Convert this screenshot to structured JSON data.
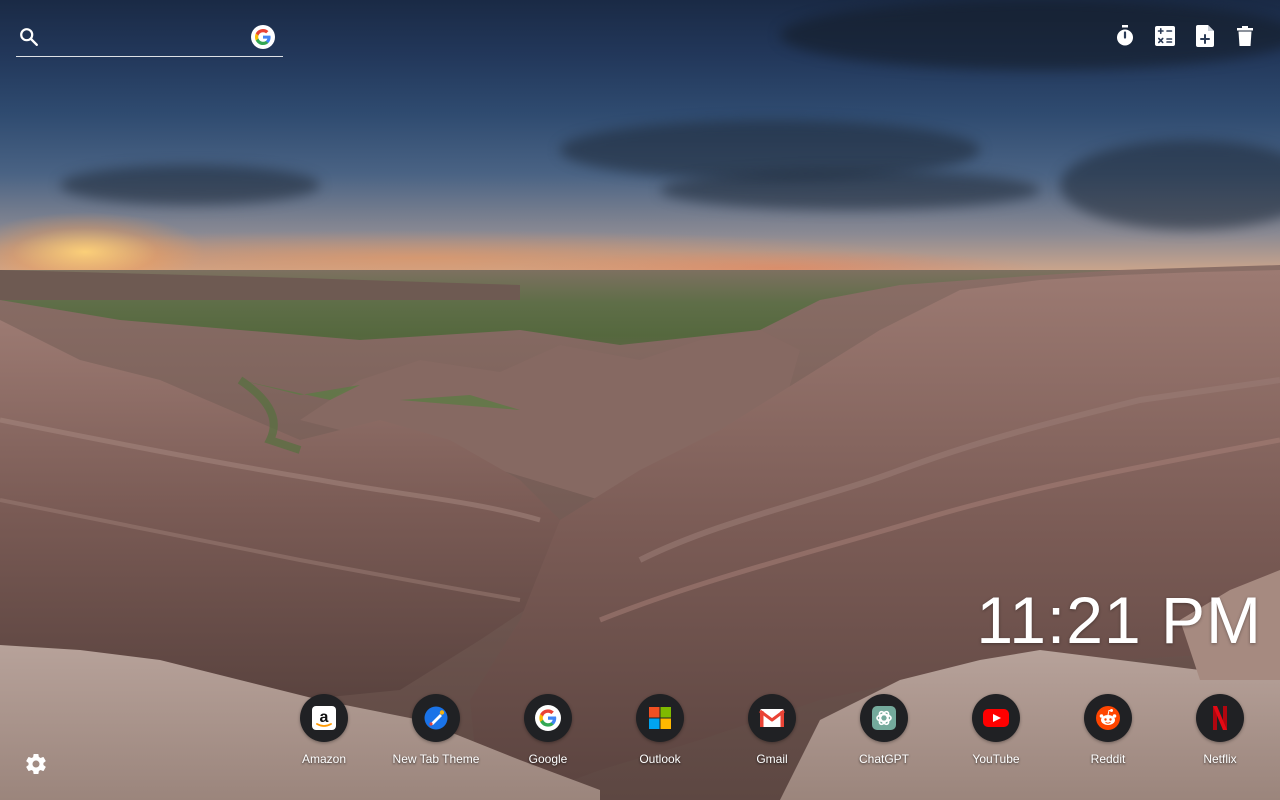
{
  "search": {
    "placeholder": ""
  },
  "toolbar": {
    "items": [
      {
        "icon": "timer-icon"
      },
      {
        "icon": "calculator-icon"
      },
      {
        "icon": "new-note-icon"
      },
      {
        "icon": "trash-icon"
      }
    ]
  },
  "clock": {
    "time": "11:21 PM"
  },
  "shortcuts": [
    {
      "label": "Amazon",
      "icon": "amazon-icon"
    },
    {
      "label": "New Tab Theme",
      "icon": "new-tab-theme-icon"
    },
    {
      "label": "Google",
      "icon": "google-icon"
    },
    {
      "label": "Outlook",
      "icon": "outlook-icon"
    },
    {
      "label": "Gmail",
      "icon": "gmail-icon"
    },
    {
      "label": "ChatGPT",
      "icon": "chatgpt-icon"
    },
    {
      "label": "YouTube",
      "icon": "youtube-icon"
    },
    {
      "label": "Reddit",
      "icon": "reddit-icon"
    },
    {
      "label": "Netflix",
      "icon": "netflix-icon"
    }
  ],
  "colors": {
    "shortcut_bg": "#202124",
    "google_blue": "#4285F4",
    "google_red": "#EA4335",
    "google_yellow": "#FBBC05",
    "google_green": "#34A853",
    "youtube_red": "#FF0000",
    "reddit_orange": "#FF4500",
    "netflix_red": "#E50914"
  },
  "background": {
    "scene": "badlands-canyon-sunset"
  }
}
